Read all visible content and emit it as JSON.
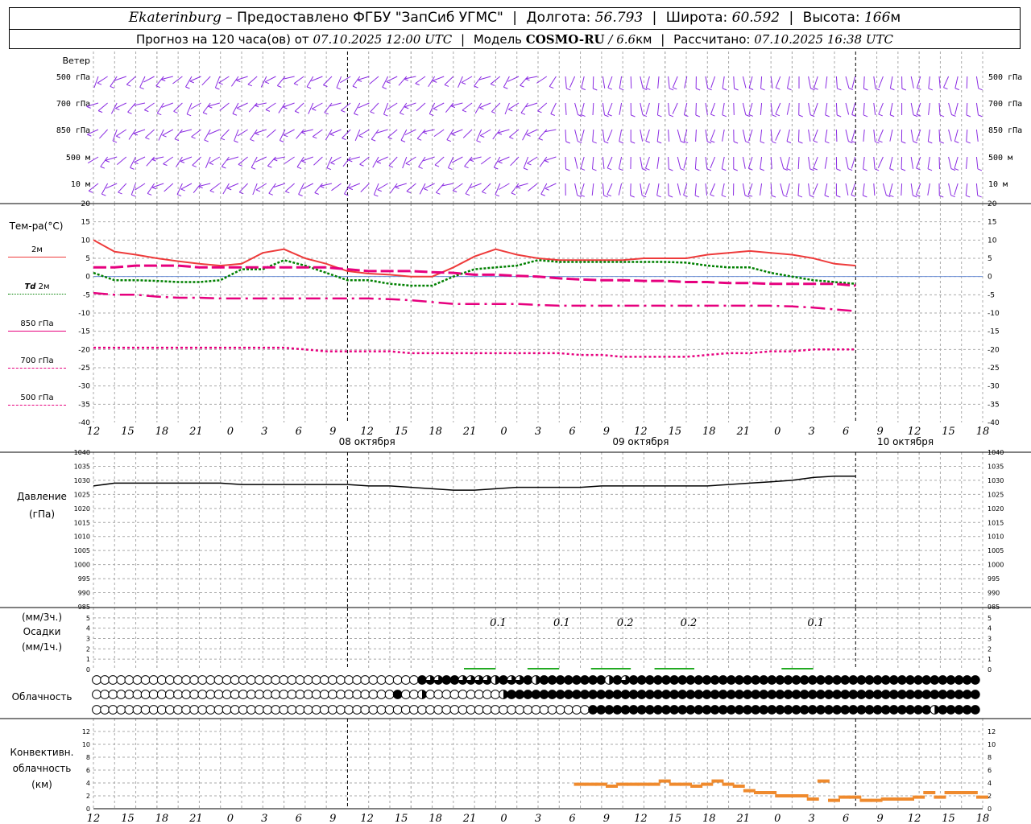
{
  "header": {
    "city": "Ekaterinburg",
    "provider": "– Предоставлено ФГБУ \"ЗапСиб УГМС\"",
    "lon_label": "Долгота:",
    "lon": "56.793",
    "lat_label": "Широта:",
    "lat": "60.592",
    "alt_label": "Высота:",
    "alt": "166",
    "alt_unit": "м",
    "forecast_label": "Прогноз на 120 часа(ов) от",
    "forecast_from": "07.10.2025 12:00 UTC",
    "model_label": "Модель",
    "model": "COSMO-RU",
    "model_res": "/ 6.6",
    "model_res_unit": "км",
    "calc_label": "Рассчитано:",
    "calc_time": "07.10.2025 16:38 UTC"
  },
  "labels": {
    "wind": "Ветер",
    "temp": "Тем-ра(°C)",
    "t2m": "2м",
    "td_pre": "Td",
    "td": "2м",
    "t850": "850 гПа",
    "t700": "700 гПа",
    "t500": "500 гПа",
    "pressure": "Давление",
    "pressure_unit": "(гПа)",
    "precip_unit3": "(мм/3ч.)",
    "precip": "Осадки",
    "precip_unit1": "(мм/1ч.)",
    "cloud": "Облачность",
    "conv1": "Конвективн.",
    "conv2": "облачность",
    "conv3": "(км)"
  },
  "wind_levels": [
    "500 гПа",
    "700 гПа",
    "850 гПа",
    "500 м",
    "10  м"
  ],
  "x_ticks": [
    "12",
    "15",
    "18",
    "21",
    "0",
    "3",
    "6",
    "9",
    "12",
    "15",
    "18",
    "21",
    "0",
    "3",
    "6",
    "9",
    "12",
    "15",
    "18",
    "21",
    "0",
    "3",
    "6",
    "9",
    "12",
    "15",
    "18"
  ],
  "dates": [
    {
      "i": 8,
      "text": "08 октября"
    },
    {
      "i": 16,
      "text": "09 октября"
    },
    {
      "i": 24,
      "text": "10 октября"
    }
  ],
  "colors": {
    "t2m": "#ee3b3b",
    "td2m": "#008000",
    "t850": "#e6007e",
    "t700": "#e6007e",
    "t500": "#e6007e",
    "wind": "#8a2be2",
    "pres": "#000000",
    "precip": "#22aa22",
    "conv": "#ef8a2d"
  },
  "chart_data": [
    {
      "type": "line",
      "title": "Тем-ра(°C)",
      "ylim": [
        -40,
        20
      ],
      "y_ticks": [
        "20",
        "15",
        "10",
        "5",
        "0",
        "-5",
        "-10",
        "-15",
        "-20",
        "-25",
        "-30",
        "-35",
        "-40"
      ],
      "x": [
        0,
        3,
        6,
        9,
        12,
        15,
        18,
        21,
        24,
        27,
        30,
        33,
        36,
        39,
        42,
        45,
        48,
        51,
        54,
        57,
        60,
        63,
        66,
        69,
        72,
        75,
        78,
        81,
        84,
        87,
        90,
        93,
        96,
        99,
        102,
        105,
        108,
        111,
        114,
        117,
        120,
        123,
        126
      ],
      "series": [
        {
          "name": "2м",
          "values": [
            10,
            6.8,
            6,
            5,
            4.2,
            3.5,
            3,
            3.5,
            6.5,
            7.5,
            5,
            3.5,
            1.5,
            0.8,
            0.5,
            0,
            0,
            2.5,
            5.5,
            7.5,
            6,
            5,
            4.5,
            4.5,
            4.5,
            4.5,
            5,
            5,
            5,
            6,
            6.5,
            7,
            6.5,
            6,
            5,
            3.5,
            3
          ]
        },
        {
          "name": "Td 2м",
          "values": [
            1,
            -1,
            -1,
            -1.2,
            -1.5,
            -1.5,
            -1,
            2,
            2,
            4.5,
            3,
            1,
            -1,
            -1,
            -2,
            -2.5,
            -2.5,
            0,
            2,
            2.5,
            3,
            4.5,
            4,
            4,
            4,
            4,
            4,
            4,
            3.8,
            3,
            2.5,
            2.5,
            1,
            0,
            -1,
            -1.5,
            -2
          ]
        },
        {
          "name": "850 гПа",
          "values": [
            2.5,
            2.5,
            3,
            3,
            3,
            2.5,
            2.5,
            2.5,
            2.5,
            2.5,
            2.5,
            2.5,
            2,
            1.5,
            1.5,
            1.5,
            1.2,
            1,
            0.5,
            0.5,
            0.2,
            0,
            -0.5,
            -0.8,
            -1,
            -1,
            -1.2,
            -1.2,
            -1.5,
            -1.5,
            -1.8,
            -1.8,
            -2,
            -2,
            -2,
            -2,
            -2.5
          ]
        },
        {
          "name": "700 гПа",
          "values": [
            -4.5,
            -5,
            -5,
            -5.5,
            -5.8,
            -5.8,
            -6,
            -6,
            -6,
            -6,
            -6,
            -6,
            -6,
            -6,
            -6.2,
            -6.5,
            -7,
            -7.5,
            -7.5,
            -7.5,
            -7.5,
            -7.8,
            -8,
            -8,
            -8,
            -8,
            -8,
            -8,
            -8,
            -8,
            -8,
            -8,
            -8,
            -8.2,
            -8.5,
            -9,
            -9.5
          ]
        },
        {
          "name": "500 гПа",
          "values": [
            -19.5,
            -19.5,
            -19.5,
            -19.5,
            -19.5,
            -19.5,
            -19.5,
            -19.5,
            -19.5,
            -19.5,
            -20,
            -20.5,
            -20.5,
            -20.5,
            -20.5,
            -21,
            -21,
            -21,
            -21,
            -21,
            -21,
            -21,
            -21,
            -21.5,
            -21.5,
            -22,
            -22,
            -22,
            -22,
            -21.5,
            -21,
            -21,
            -20.5,
            -20.5,
            -20,
            -20,
            -20
          ]
        }
      ]
    },
    {
      "type": "line",
      "title": "Давление",
      "ylabel": "(гПа)",
      "ylim": [
        985,
        1040
      ],
      "y_ticks": [
        "1040",
        "1035",
        "1030",
        "1025",
        "1020",
        "1015",
        "1010",
        "1005",
        "1000",
        "995",
        "990",
        "985"
      ],
      "x": [
        0,
        3,
        6,
        9,
        12,
        15,
        18,
        21,
        24,
        27,
        30,
        33,
        36,
        39,
        42,
        45,
        48,
        51,
        54,
        57,
        60,
        63,
        66,
        69,
        72,
        75,
        78,
        81,
        84,
        87,
        90,
        93,
        96,
        99,
        102,
        105,
        108,
        111,
        114,
        117,
        120,
        123,
        126
      ],
      "series": [
        {
          "values": [
            1028,
            1029,
            1029,
            1029,
            1029,
            1029,
            1029,
            1028.5,
            1028.5,
            1028.5,
            1028.5,
            1028.5,
            1028.5,
            1028,
            1028,
            1027.5,
            1027,
            1026.5,
            1026.5,
            1027,
            1027.5,
            1027.5,
            1027.5,
            1027.5,
            1028,
            1028,
            1028,
            1028,
            1028,
            1028,
            1028.5,
            1029,
            1029.5,
            1030,
            1031,
            1031.5,
            1031.5
          ]
        }
      ]
    },
    {
      "type": "bar",
      "title": "Осадки",
      "ylim": [
        0,
        5
      ],
      "y_ticks": [
        "5",
        "4",
        "3",
        "2",
        "1",
        "0"
      ],
      "bars": [
        {
          "x": 57,
          "value": 0.1,
          "label": "0.1"
        },
        {
          "x": 66,
          "value": 0.1,
          "label": "0.1"
        },
        {
          "x": 75,
          "value": 0.2,
          "label": "0.2"
        },
        {
          "x": 84,
          "value": 0.2,
          "label": "0.2"
        },
        {
          "x": 102,
          "value": 0.1,
          "label": "0.1"
        }
      ]
    },
    {
      "type": "bar",
      "title": "Конвективн. облачность (км)",
      "ylim": [
        0,
        14
      ],
      "y_ticks": [
        "12",
        "10",
        "8",
        "6",
        "4",
        "2",
        "0"
      ],
      "segments": [
        {
          "x": 69,
          "v": 3.8
        },
        {
          "x": 70.5,
          "v": 3.8
        },
        {
          "x": 72,
          "v": 3.8
        },
        {
          "x": 73.5,
          "v": 3.5
        },
        {
          "x": 75,
          "v": 3.8
        },
        {
          "x": 76.5,
          "v": 3.8
        },
        {
          "x": 78,
          "v": 3.8
        },
        {
          "x": 79.5,
          "v": 3.8
        },
        {
          "x": 81,
          "v": 4.3
        },
        {
          "x": 82.5,
          "v": 3.8
        },
        {
          "x": 84,
          "v": 3.8
        },
        {
          "x": 85.5,
          "v": 3.5
        },
        {
          "x": 87,
          "v": 3.8
        },
        {
          "x": 88.5,
          "v": 4.3
        },
        {
          "x": 90,
          "v": 3.8
        },
        {
          "x": 91.5,
          "v": 3.5
        },
        {
          "x": 93,
          "v": 2.8
        },
        {
          "x": 94.5,
          "v": 2.5
        },
        {
          "x": 96,
          "v": 2.5
        },
        {
          "x": 97.5,
          "v": 2
        },
        {
          "x": 99,
          "v": 2
        },
        {
          "x": 100.5,
          "v": 2
        },
        {
          "x": 102,
          "v": 1.5
        },
        {
          "x": 103.5,
          "v": 4.3
        },
        {
          "x": 105,
          "v": 1.3
        },
        {
          "x": 106.5,
          "v": 1.8
        },
        {
          "x": 108,
          "v": 1.8
        },
        {
          "x": 109.5,
          "v": 1.3
        },
        {
          "x": 111,
          "v": 1.3
        },
        {
          "x": 112.5,
          "v": 1.5
        },
        {
          "x": 114,
          "v": 1.5
        },
        {
          "x": 115.5,
          "v": 1.5
        },
        {
          "x": 117,
          "v": 1.8
        },
        {
          "x": 118.5,
          "v": 2.5
        },
        {
          "x": 120,
          "v": 1.8
        },
        {
          "x": 121.5,
          "v": 2.5
        },
        {
          "x": 123,
          "v": 2.5
        },
        {
          "x": 124.5,
          "v": 2.5
        },
        {
          "x": 126,
          "v": 1.8
        }
      ]
    }
  ],
  "cloud_rows": [
    "oooooooooooooooooooooooooooooooooooooooohqqhhqqqq3hqqh3hhhhhhhh3hqhhhhhhhhhhhhhhhhhhhhhhhhhhhhhhhhhhhhhhhhhhhh",
    "ooooooooooooooooooooooooooooooooooooohoo3ooooooooo3hhhhhhhhhhhhhhhhhhhhhhhhhhhhhhhhhhhhhhhhhhhhhhhhhhhhhhhhhhhh",
    "ooooooooooooooooooooooooooooooooooooooooooooooooooooooooooooohhhhhhhhhhhhhhhhhhhhhhhhhhhhhhhhhhhhhhhhhh3hhhhhhh"
  ]
}
